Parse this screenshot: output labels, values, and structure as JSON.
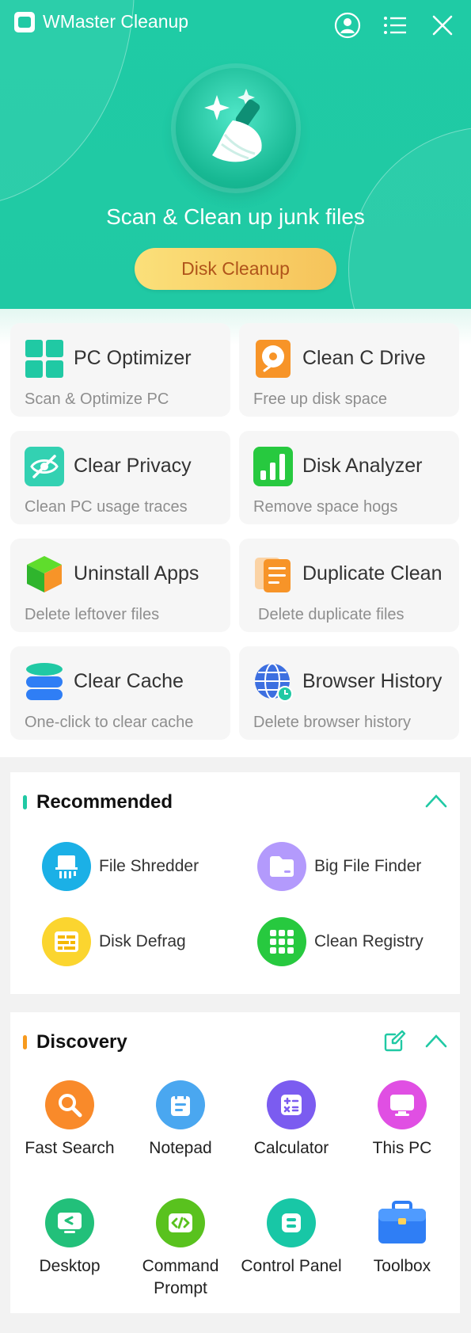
{
  "app": {
    "title": "WMaster Cleanup",
    "icons": {
      "logo": "app-logo-icon",
      "account": "user-icon",
      "menu": "menu-icon",
      "close": "close-icon"
    }
  },
  "hero": {
    "headline": "Scan & Clean up junk files",
    "button_label": "Disk Cleanup",
    "icon": "broom-icon",
    "colors": {
      "background": "#20c9a4",
      "button": "#f6c35a",
      "button_text": "#b0541a"
    }
  },
  "features": [
    {
      "name": "PC Optimizer",
      "desc": "Scan & Optimize PC",
      "icon": "windows-grid-icon"
    },
    {
      "name": "Clean C Drive",
      "desc": "Free up disk space",
      "icon": "disk-icon"
    },
    {
      "name": "Clear Privacy",
      "desc": "Clean PC usage traces",
      "icon": "eye-off-icon"
    },
    {
      "name": "Disk Analyzer",
      "desc": "Remove space hogs",
      "icon": "bar-chart-icon"
    },
    {
      "name": "Uninstall Apps",
      "desc": "Delete leftover files",
      "icon": "cube-icon"
    },
    {
      "name": "Duplicate Clean",
      "desc": "Delete duplicate files",
      "icon": "documents-icon"
    },
    {
      "name": "Clear Cache",
      "desc": "One-click to clear cache",
      "icon": "database-icon"
    },
    {
      "name": "Browser History",
      "desc": "Delete browser history",
      "icon": "globe-icon"
    }
  ],
  "recommended": {
    "title": "Recommended",
    "accent": "#20c9a4",
    "items": [
      {
        "label": "File Shredder",
        "icon": "shredder-icon",
        "color": "#1bb0e6"
      },
      {
        "label": "Big File Finder",
        "icon": "folder-icon",
        "color": "#b39afc"
      },
      {
        "label": "Disk Defrag",
        "icon": "defrag-icon",
        "color": "#fbd52f"
      },
      {
        "label": "Clean Registry",
        "icon": "registry-grid-icon",
        "color": "#27c93f"
      }
    ]
  },
  "discovery": {
    "title": "Discovery",
    "accent": "#f79a1e",
    "items": [
      {
        "label": "Fast Search",
        "icon": "search-icon",
        "color": "#f98a2a"
      },
      {
        "label": "Notepad",
        "icon": "notepad-icon",
        "color": "#4aa7f0"
      },
      {
        "label": "Calculator",
        "icon": "calculator-icon",
        "color": "#7b5cf0"
      },
      {
        "label": "This PC",
        "icon": "monitor-icon",
        "color": "#e04fe3"
      },
      {
        "label": "Desktop",
        "icon": "desktop-icon",
        "color": "#22c07a"
      },
      {
        "label": "Command Prompt",
        "icon": "code-icon",
        "color": "#59c21e"
      },
      {
        "label": "Control Panel",
        "icon": "control-panel-icon",
        "color": "#18c7a6"
      },
      {
        "label": "Toolbox",
        "icon": "toolbox-icon",
        "color": "#2f7ef5"
      }
    ]
  }
}
